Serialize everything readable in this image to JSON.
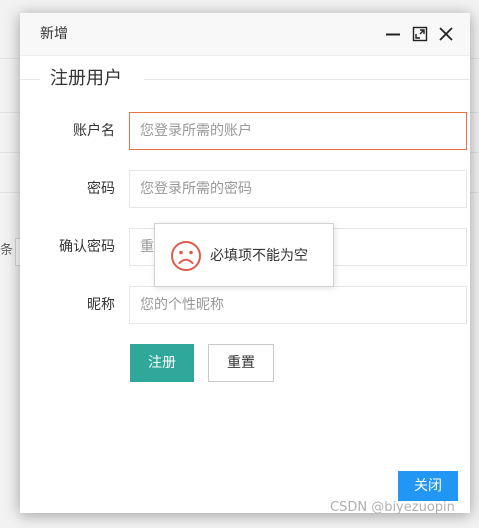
{
  "background": {
    "fragment_text": "条"
  },
  "dialog": {
    "title": "新增",
    "legend": "注册用户",
    "fields": [
      {
        "label": "账户名",
        "placeholder": "您登录所需的账户",
        "value": ""
      },
      {
        "label": "密码",
        "placeholder": "您登录所需的密码",
        "value": ""
      },
      {
        "label": "确认密码",
        "placeholder": "重",
        "value": ""
      },
      {
        "label": "昵称",
        "placeholder": "您的个性昵称",
        "value": ""
      }
    ],
    "register_label": "注册",
    "reset_label": "重置",
    "close_label": "关闭"
  },
  "toast": {
    "message": "必填项不能为空",
    "icon": "sad-face-icon"
  },
  "watermark": "CSDN @biyezuopin",
  "colors": {
    "primary": "#2fa79a",
    "close_button": "#2196f3",
    "focus_border": "#e8733e",
    "toast_icon": "#e05b4c"
  }
}
